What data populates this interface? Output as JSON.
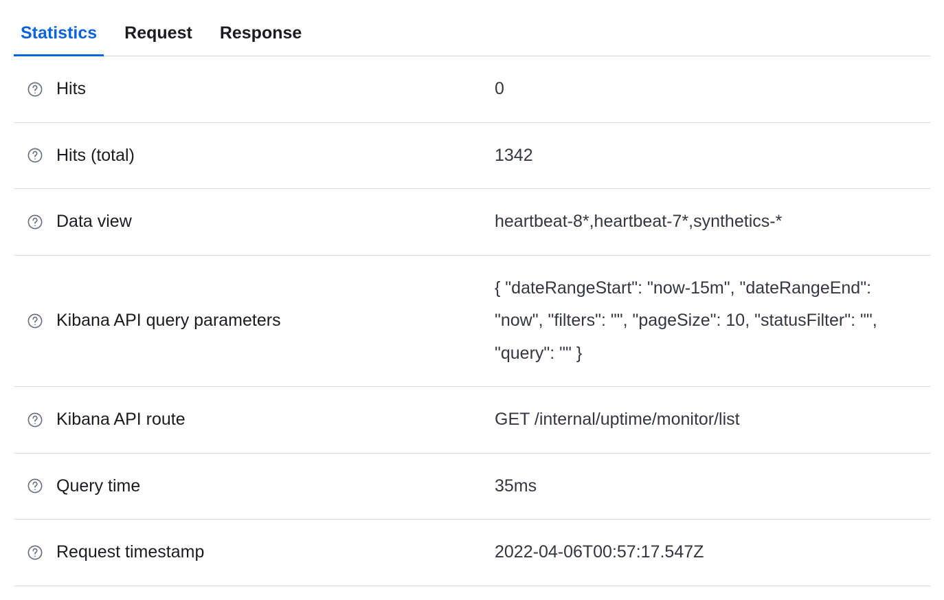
{
  "tabs": [
    {
      "label": "Statistics",
      "active": true
    },
    {
      "label": "Request",
      "active": false
    },
    {
      "label": "Response",
      "active": false
    }
  ],
  "stats": [
    {
      "label": "Hits",
      "value": "0"
    },
    {
      "label": "Hits (total)",
      "value": "1342"
    },
    {
      "label": "Data view",
      "value": "heartbeat-8*,heartbeat-7*,synthetics-*"
    },
    {
      "label": "Kibana API query parameters",
      "value": "{ \"dateRangeStart\": \"now-15m\", \"dateRangeEnd\": \"now\", \"filters\": \"\", \"pageSize\": 10, \"statusFilter\": \"\", \"query\": \"\" }"
    },
    {
      "label": "Kibana API route",
      "value": "GET /internal/uptime/monitor/list"
    },
    {
      "label": "Query time",
      "value": "35ms"
    },
    {
      "label": "Request timestamp",
      "value": "2022-04-06T00:57:17.547Z"
    }
  ]
}
